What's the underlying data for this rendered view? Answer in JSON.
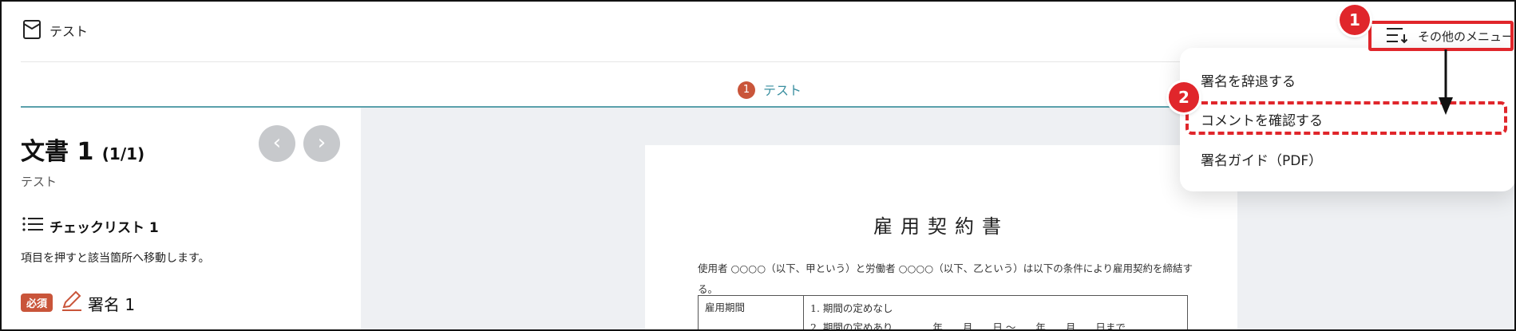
{
  "header": {
    "app_title": "テスト",
    "menu_label": "その他のメニュー"
  },
  "steps": {
    "current_number": "1",
    "current_label": "テスト"
  },
  "left_panel": {
    "doc_title": "文書 1",
    "doc_count": "(1/1)",
    "doc_subtitle": "テスト",
    "checklist_title": "チェックリスト 1",
    "checklist_desc": "項目を押すと該当箇所へ移動します。",
    "required_badge": "必須",
    "signature_label": "署名 1",
    "prev_glyph": "‹",
    "next_glyph": "›"
  },
  "dropdown": {
    "items": [
      {
        "label": "署名を辞退する"
      },
      {
        "label": "コメントを確認する"
      },
      {
        "label": "署名ガイド（PDF）"
      }
    ]
  },
  "document_page": {
    "title": "雇用契約書",
    "intro": "使用者 ○○○○（以下、甲という）と労働者 ○○○○（以下、乙という）は以下の条件により雇用契約を締結する。",
    "table": {
      "row1_label": "雇用期間",
      "option1": "1. 期間の定めなし",
      "option2": "2. 期間の定めあり　　　　年　　月　　日 〜　　年　　月　　日まで"
    }
  },
  "annotations": {
    "callout_1": "1",
    "callout_2": "2"
  },
  "colors": {
    "accent_red": "#e0262b",
    "badge_red": "#c9553a",
    "teal": "#3a8fa0"
  }
}
